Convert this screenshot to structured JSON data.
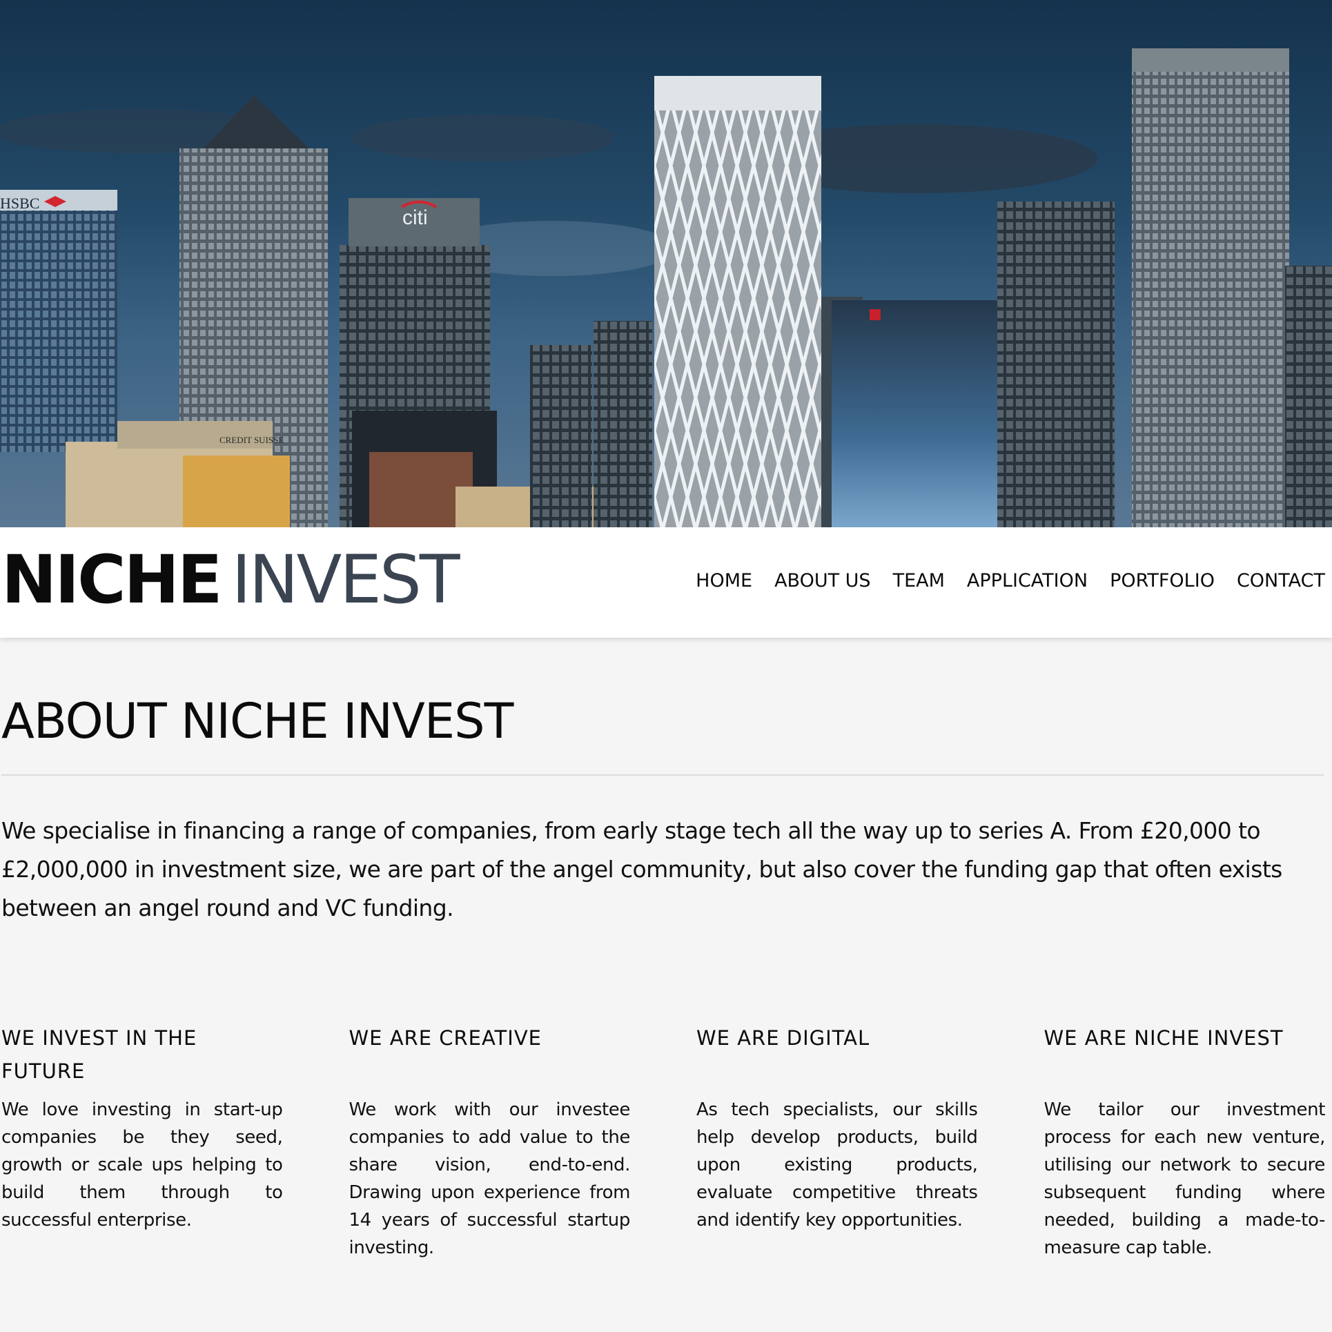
{
  "brand": {
    "bold": "NICHE",
    "light": "INVEST"
  },
  "nav": [
    {
      "label": "HOME"
    },
    {
      "label": "ABOUT US"
    },
    {
      "label": "TEAM"
    },
    {
      "label": "APPLICATION"
    },
    {
      "label": "PORTFOLIO"
    },
    {
      "label": "CONTACT"
    }
  ],
  "hero": {
    "signs": {
      "hsbc": "HSBC",
      "citi": "citi",
      "credit_suisse": "CREDIT SUISSE"
    }
  },
  "about": {
    "title": "ABOUT NICHE INVEST",
    "intro": "We specialise in financing a range of companies, from early stage tech all the way up to series A. From £20,000 to £2,000,000 in investment size, we are part of the angel community, but also cover the funding gap that often exists between an angel round and VC funding."
  },
  "features": [
    {
      "title": "WE INVEST IN THE FUTURE",
      "text": "We love investing in start-up companies be they seed, growth or scale ups helping to build them through to successful enterprise."
    },
    {
      "title": "WE ARE CREATIVE",
      "text": "We work with our investee companies to add value to the share vision, end-to-end. Drawing upon experience from 14 years of successful startup investing."
    },
    {
      "title": "WE ARE DIGITAL",
      "text": "As tech specialists, our skills help develop products, build upon existing products, evaluate competitive threats and identify key opportunities."
    },
    {
      "title": "WE ARE NICHE INVEST",
      "text": "We tailor our investment process for each new venture, utilising our network to secure subsequent funding where needed, building a made-to-measure cap table."
    }
  ]
}
